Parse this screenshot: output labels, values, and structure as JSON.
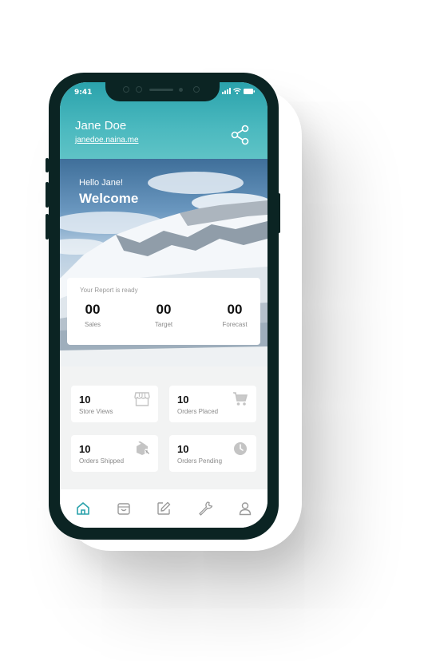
{
  "status_bar": {
    "time": "9:41"
  },
  "header": {
    "user_name": "Jane Doe",
    "user_link": "janedoe.naina.me",
    "share_icon": "share-icon"
  },
  "hero": {
    "greeting": "Hello Jane!",
    "welcome": "Welcome"
  },
  "report": {
    "title": "Your Report is ready",
    "metrics": [
      {
        "value": "00",
        "label": "Sales"
      },
      {
        "value": "00",
        "label": "Target"
      },
      {
        "value": "00",
        "label": "Forecast"
      }
    ]
  },
  "stats": [
    {
      "value": "10",
      "label": "Store Views",
      "icon": "store-icon"
    },
    {
      "value": "10",
      "label": "Orders Placed",
      "icon": "cart-icon"
    },
    {
      "value": "10",
      "label": "Orders Shipped",
      "icon": "shipped-box-icon"
    },
    {
      "value": "10",
      "label": "Orders Pending",
      "icon": "clock-icon"
    }
  ],
  "bottom_nav": [
    {
      "icon": "home-icon",
      "active": true
    },
    {
      "icon": "shopping-bag-icon",
      "active": false
    },
    {
      "icon": "edit-icon",
      "active": false
    },
    {
      "icon": "wrench-icon",
      "active": false
    },
    {
      "icon": "user-icon",
      "active": false
    }
  ],
  "colors": {
    "accent": "#2aa2ab",
    "icon_gray": "#c4c4c4",
    "nav_gray": "#9a9a9a"
  }
}
